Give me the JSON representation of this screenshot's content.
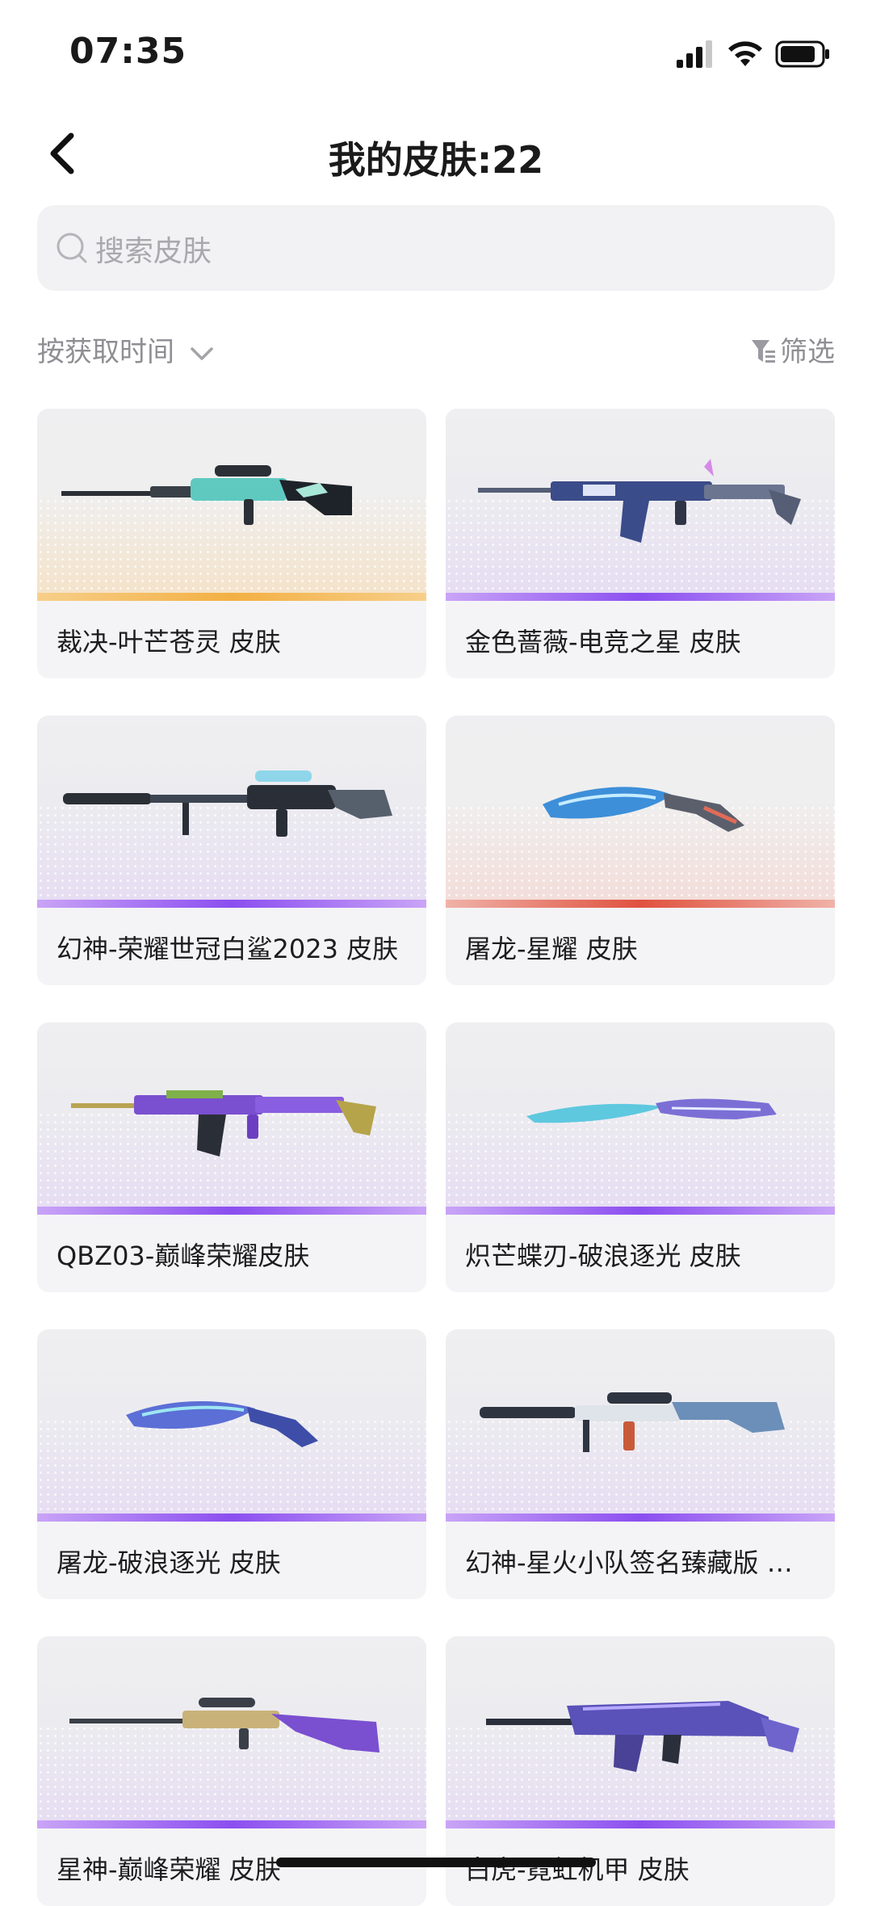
{
  "status_bar": {
    "time": "07:35"
  },
  "header": {
    "title": "我的皮肤:22"
  },
  "search": {
    "placeholder": "搜索皮肤"
  },
  "toolbar": {
    "sort_label": "按获取时间",
    "filter_label": "筛选"
  },
  "colors": {
    "purple_bar": "#8b4ef0",
    "gold_bar": "#f3b043",
    "red_bar": "#e0523f"
  },
  "skins": [
    {
      "name": "裁决-叶芒苍灵 皮肤",
      "rarity_color": "gold",
      "icon": "sniper-rifle-icon"
    },
    {
      "name": "金色蔷薇-电竞之星 皮肤",
      "rarity_color": "purple",
      "icon": "assault-rifle-icon"
    },
    {
      "name": "幻神-荣耀世冠白鲨2023 皮肤",
      "rarity_color": "purple",
      "icon": "sniper-rifle-icon"
    },
    {
      "name": "屠龙-星耀 皮肤",
      "rarity_color": "red",
      "icon": "blade-icon"
    },
    {
      "name": "QBZ03-巅峰荣耀皮肤",
      "rarity_color": "purple",
      "icon": "assault-rifle-icon"
    },
    {
      "name": "炽芒蝶刃-破浪逐光 皮肤",
      "rarity_color": "purple",
      "icon": "blade-icon"
    },
    {
      "name": "屠龙-破浪逐光 皮肤",
      "rarity_color": "purple",
      "icon": "blade-icon"
    },
    {
      "name": "幻神-星火小队签名臻藏版 …",
      "rarity_color": "purple",
      "icon": "sniper-rifle-icon"
    },
    {
      "name": "星神-巅峰荣耀 皮肤",
      "rarity_color": "purple",
      "icon": "sniper-rifle-icon"
    },
    {
      "name": "白虎-霓虹机甲 皮肤",
      "rarity_color": "purple",
      "icon": "assault-rifle-icon"
    }
  ]
}
